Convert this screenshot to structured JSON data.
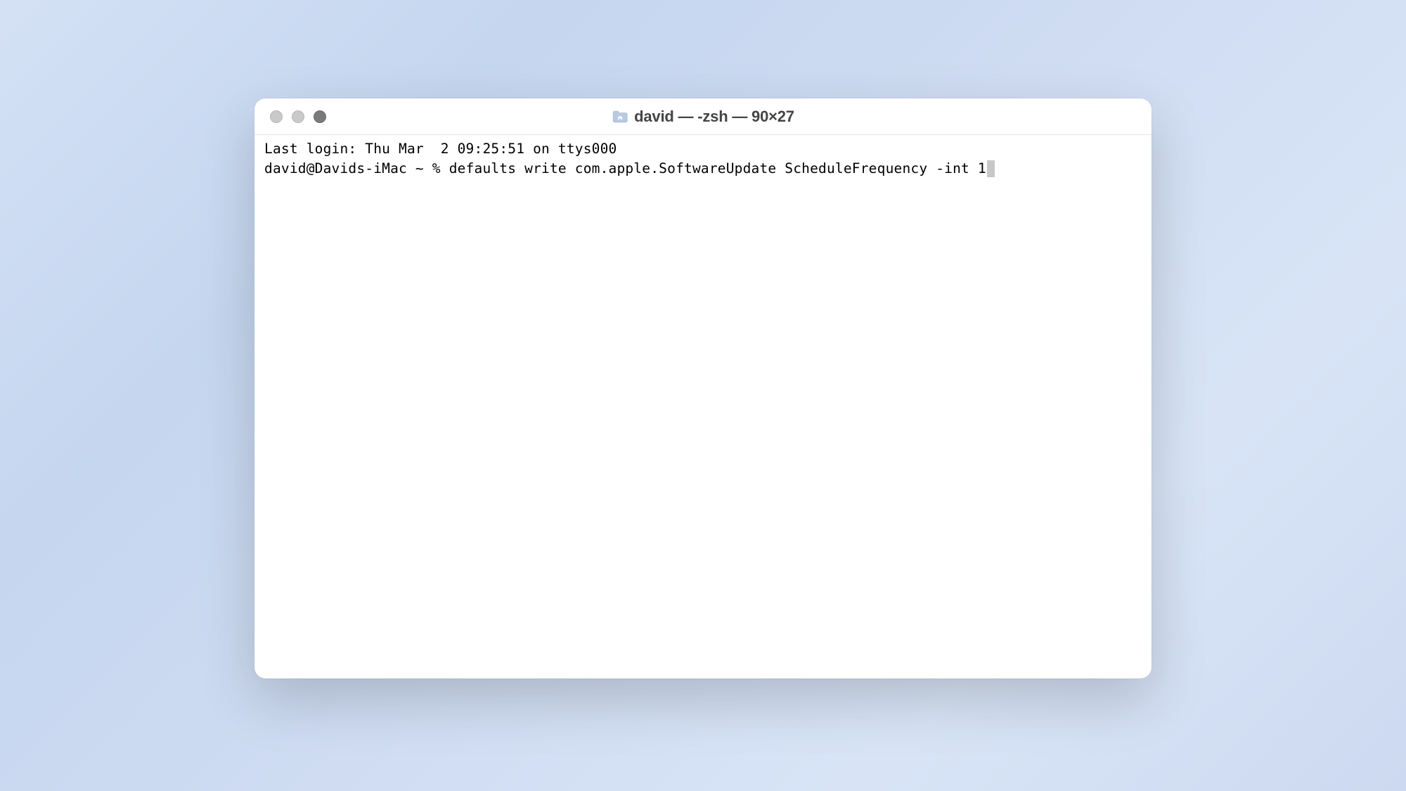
{
  "window": {
    "title": "david — -zsh — 90×27"
  },
  "terminal": {
    "last_login": "Last login: Thu Mar  2 09:25:51 on ttys000",
    "prompt": "david@Davids-iMac ~ % ",
    "command": "defaults write com.apple.SoftwareUpdate ScheduleFrequency -int 1"
  }
}
